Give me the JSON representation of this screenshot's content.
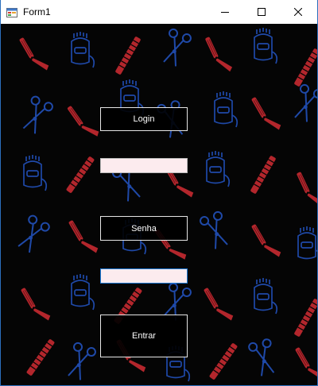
{
  "window": {
    "title": "Form1",
    "icons": {
      "app": "form-app-icon",
      "minimize": "minimize-icon",
      "maximize": "maximize-icon",
      "close": "close-icon"
    }
  },
  "form": {
    "login_label": "Login",
    "login_value": "",
    "password_label": "Senha",
    "password_value": "",
    "submit_label": "Entrar"
  },
  "background": {
    "pattern": [
      "straight-razor-icon",
      "scissors-icon",
      "hair-clipper-icon",
      "comb-icon"
    ],
    "colors": {
      "base": "#050505",
      "red": "#b3262c",
      "blue": "#1f49a8"
    }
  }
}
